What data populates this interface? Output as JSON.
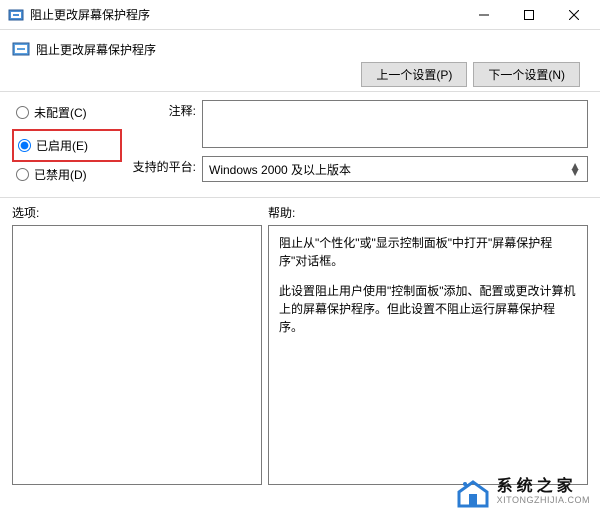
{
  "window": {
    "title": "阻止更改屏幕保护程序"
  },
  "header": {
    "title": "阻止更改屏幕保护程序",
    "prev_button": "上一个设置(P)",
    "next_button": "下一个设置(N)"
  },
  "radio": {
    "not_configured": "未配置(C)",
    "enabled": "已启用(E)",
    "disabled": "已禁用(D)",
    "selected": "enabled"
  },
  "form": {
    "comment_label": "注释:",
    "comment_value": "",
    "platform_label": "支持的平台:",
    "platform_value": "Windows 2000 及以上版本"
  },
  "sections": {
    "options_label": "选项:",
    "help_label": "帮助:"
  },
  "help": {
    "p1": "阻止从\"个性化\"或\"显示控制面板\"中打开\"屏幕保护程序\"对话框。",
    "p2": "此设置阻止用户使用\"控制面板\"添加、配置或更改计算机上的屏幕保护程序。但此设置不阻止运行屏幕保护程序。"
  },
  "watermark": {
    "cn": "系统之家",
    "en": "XITONGZHIJIA.COM"
  }
}
